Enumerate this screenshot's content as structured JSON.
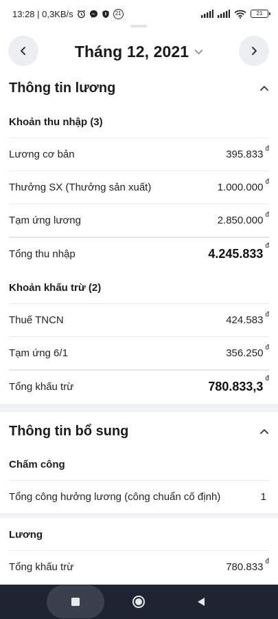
{
  "status_bar": {
    "time_speed": "13:28 | 0,3KB/s",
    "notif_badge": "21",
    "battery": "21"
  },
  "header": {
    "month_title": "Tháng 12, 2021"
  },
  "salary_section": {
    "title": "Thông tin lương",
    "income_group": {
      "title": "Khoản thu nhập (3)",
      "rows": [
        {
          "label": "Lương cơ bản",
          "value": "395.833"
        },
        {
          "label": "Thưởng SX (Thưởng sản xuất)",
          "value": "1.000.000"
        },
        {
          "label": "Tạm ứng lương",
          "value": "2.850.000"
        }
      ],
      "total": {
        "label": "Tổng thu nhập",
        "value": "4.245.833"
      }
    },
    "deduction_group": {
      "title": "Khoản khấu trừ (2)",
      "rows": [
        {
          "label": "Thuế TNCN",
          "value": "424.583"
        },
        {
          "label": "Tạm ứng 6/1",
          "value": "356.250"
        }
      ],
      "total": {
        "label": "Tổng khấu trừ",
        "value": "780.833,3"
      }
    }
  },
  "extra_section": {
    "title": "Thông tin bổ sung",
    "attendance_group": {
      "title": "Chấm công",
      "rows": [
        {
          "label": "Tổng công hưởng lương (công chuẩn cố định)",
          "value": "1"
        }
      ]
    },
    "salary_group": {
      "title": "Lương",
      "rows": [
        {
          "label": "Tổng khấu trừ",
          "value": "780.833"
        }
      ]
    }
  },
  "currency_symbol": "đ",
  "icons": {
    "prev": "chevron-left-icon",
    "next": "chevron-right-icon",
    "dropdown": "chevron-down-icon",
    "collapse": "chevron-up-icon"
  },
  "colors": {
    "nav_button_bg": "#eceef2",
    "divider": "#ececef",
    "band": "#f1f2f5",
    "system_nav_bg": "#1f2530"
  }
}
